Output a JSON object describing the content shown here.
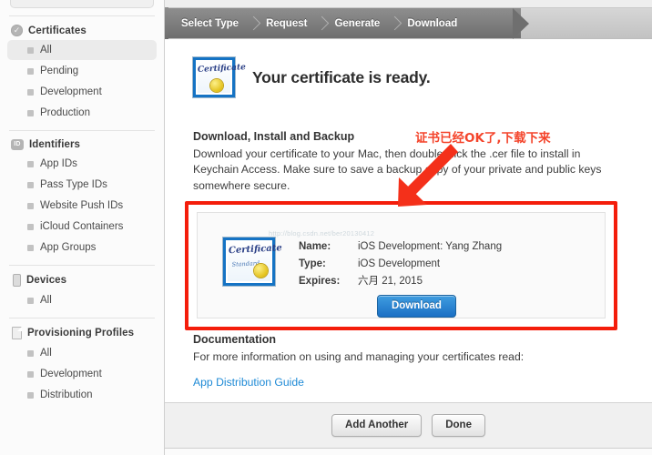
{
  "sidebar": {
    "groups": [
      {
        "label": "Certificates",
        "icon": "certificate-seal-icon",
        "items": [
          {
            "label": "All",
            "selected": true
          },
          {
            "label": "Pending",
            "selected": false
          },
          {
            "label": "Development",
            "selected": false
          },
          {
            "label": "Production",
            "selected": false
          }
        ]
      },
      {
        "label": "Identifiers",
        "icon": "id-badge-icon",
        "badge_text": "ID",
        "items": [
          {
            "label": "App IDs",
            "selected": false
          },
          {
            "label": "Pass Type IDs",
            "selected": false
          },
          {
            "label": "Website Push IDs",
            "selected": false
          },
          {
            "label": "iCloud Containers",
            "selected": false
          },
          {
            "label": "App Groups",
            "selected": false
          }
        ]
      },
      {
        "label": "Devices",
        "icon": "device-icon",
        "items": [
          {
            "label": "All",
            "selected": false
          }
        ]
      },
      {
        "label": "Provisioning Profiles",
        "icon": "document-icon",
        "items": [
          {
            "label": "All",
            "selected": false
          },
          {
            "label": "Development",
            "selected": false
          },
          {
            "label": "Distribution",
            "selected": false
          }
        ]
      }
    ]
  },
  "steps": [
    {
      "label": "Select Type",
      "active": true
    },
    {
      "label": "Request",
      "active": true
    },
    {
      "label": "Generate",
      "active": true
    },
    {
      "label": "Download",
      "active": true
    }
  ],
  "hero": {
    "title": "Your certificate is ready.",
    "icon": "certificate-icon",
    "cert_script": "Certificate"
  },
  "download_section": {
    "heading": "Download, Install and Backup",
    "body": "Download your certificate to your Mac, then double click the .cer file to install in Keychain Access. Make sure to save a backup copy of your private and public keys somewhere secure."
  },
  "certificate": {
    "icon": "certificate-icon",
    "cert_script": "Certificate",
    "cert_script_sub": "Standard",
    "watermark": "http://blog.csdn.net/ber20130412",
    "fields": [
      {
        "label": "Name:",
        "value": "iOS Development: Yang Zhang"
      },
      {
        "label": "Type:",
        "value": "iOS Development"
      },
      {
        "label": "Expires:",
        "value": "六月 21, 2015"
      }
    ],
    "download_button": "Download"
  },
  "annotation": {
    "text": "证书已经OK了,下载下来",
    "color": "#f4442b",
    "arrow": "down-left-arrow-icon",
    "highlight_color": "#f41d0b"
  },
  "documentation": {
    "heading": "Documentation",
    "body": "For more information on using and managing your certificates read:",
    "link": "App Distribution Guide"
  },
  "footer": {
    "add_another": "Add Another",
    "done": "Done"
  }
}
